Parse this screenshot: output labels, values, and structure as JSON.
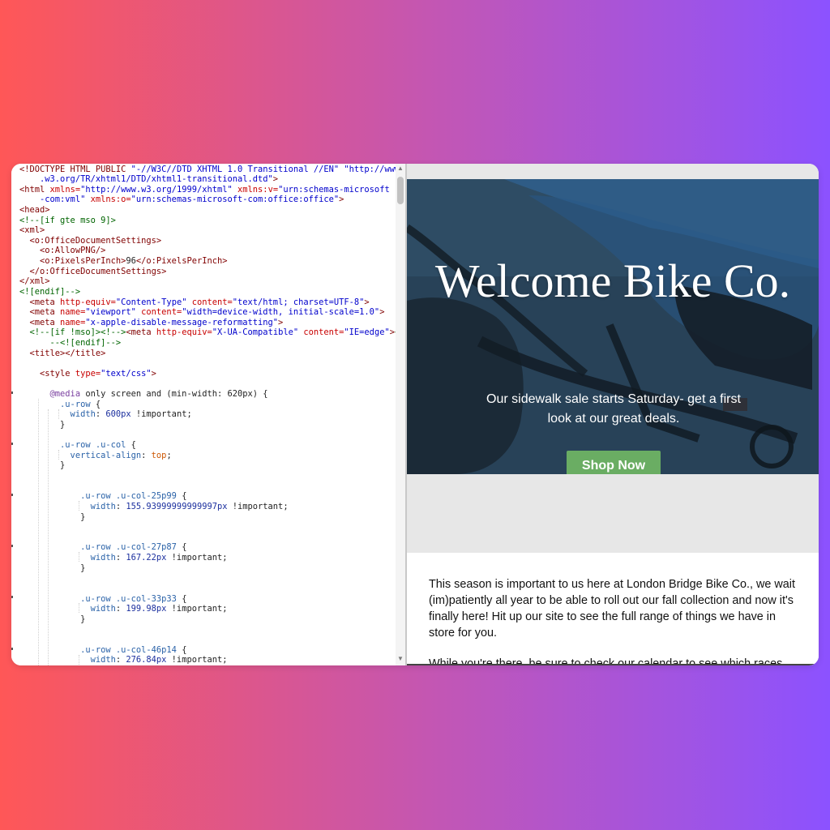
{
  "code_editor": {
    "lines": [
      [
        [
          "<!DOCTYPE HTML PUBLIC ",
          "c-tag"
        ],
        [
          "\"-//W3C//DTD XHTML 1.0 Transitional //EN\" \"http://www",
          "c-str"
        ]
      ],
      [
        [
          "    .w3.org/TR/xhtml1/DTD/xhtml1-transitional.dtd\"",
          "c-str"
        ],
        [
          ">",
          "c-tag"
        ]
      ],
      [
        [
          "<html ",
          "c-tag"
        ],
        [
          "xmlns=",
          "c-attr"
        ],
        [
          "\"http://www.w3.org/1999/xhtml\" ",
          "c-str"
        ],
        [
          "xmlns:v=",
          "c-attr"
        ],
        [
          "\"urn:schemas-microsoft",
          "c-str"
        ]
      ],
      [
        [
          "    -com:vml\" ",
          "c-str"
        ],
        [
          "xmlns:o=",
          "c-attr"
        ],
        [
          "\"urn:schemas-microsoft-com:office:office\"",
          "c-str"
        ],
        [
          ">",
          "c-tag"
        ]
      ],
      [
        [
          "<head>",
          "c-tag"
        ]
      ],
      [
        [
          "<!--[if gte mso 9]>",
          "c-cmt"
        ]
      ],
      [
        [
          "<xml>",
          "c-tag"
        ]
      ],
      [
        [
          "  <o:OfficeDocumentSettings>",
          "c-tag"
        ]
      ],
      [
        [
          "    <o:AllowPNG/>",
          "c-tag"
        ]
      ],
      [
        [
          "    <o:PixelsPerInch>",
          "c-tag"
        ],
        [
          "96",
          "c-punc"
        ],
        [
          "</o:PixelsPerInch>",
          "c-tag"
        ]
      ],
      [
        [
          "  </o:OfficeDocumentSettings>",
          "c-tag"
        ]
      ],
      [
        [
          "</xml>",
          "c-tag"
        ]
      ],
      [
        [
          "<![endif]-->",
          "c-cmt"
        ]
      ],
      [
        [
          "  <meta ",
          "c-tag"
        ],
        [
          "http-equiv=",
          "c-attr"
        ],
        [
          "\"Content-Type\" ",
          "c-str"
        ],
        [
          "content=",
          "c-attr"
        ],
        [
          "\"text/html; charset=UTF-8\"",
          "c-str"
        ],
        [
          ">",
          "c-tag"
        ]
      ],
      [
        [
          "  <meta ",
          "c-tag"
        ],
        [
          "name=",
          "c-attr"
        ],
        [
          "\"viewport\" ",
          "c-str"
        ],
        [
          "content=",
          "c-attr"
        ],
        [
          "\"width=device-width, initial-scale=1.0\"",
          "c-str"
        ],
        [
          ">",
          "c-tag"
        ]
      ],
      [
        [
          "  <meta ",
          "c-tag"
        ],
        [
          "name=",
          "c-attr"
        ],
        [
          "\"x-apple-disable-message-reformatting\"",
          "c-str"
        ],
        [
          ">",
          "c-tag"
        ]
      ],
      [
        [
          "  <!--[if !mso]><!-->",
          "c-cmt"
        ],
        [
          "<meta ",
          "c-tag"
        ],
        [
          "http-equiv=",
          "c-attr"
        ],
        [
          "\"X-UA-Compatible\" ",
          "c-str"
        ],
        [
          "content=",
          "c-attr"
        ],
        [
          "\"IE=edge\"",
          "c-str"
        ],
        [
          ">",
          "c-tag"
        ],
        [
          "<!",
          "c-cmt"
        ]
      ],
      [
        [
          "      --<![endif]-->",
          "c-cmt"
        ]
      ],
      [
        [
          "  <title></title>",
          "c-tag"
        ]
      ],
      [
        [
          "",
          "c-punc"
        ]
      ],
      [
        [
          "    <style ",
          "c-tag"
        ],
        [
          "type=",
          "c-attr"
        ],
        [
          "\"text/css\"",
          "c-str"
        ],
        [
          ">",
          "c-tag"
        ]
      ],
      [
        [
          "",
          "c-punc"
        ]
      ],
      [
        [
          "      @media ",
          "c-at"
        ],
        [
          "only screen and (min-width: 620px) {",
          "c-punc"
        ]
      ],
      [
        [
          "        .u-row ",
          "c-sel"
        ],
        [
          "{",
          "c-punc"
        ]
      ],
      [
        [
          "          width",
          "c-prop"
        ],
        [
          ": ",
          "c-punc"
        ],
        [
          "600px",
          "c-num"
        ],
        [
          " !important;",
          "c-punc"
        ]
      ],
      [
        [
          "        }",
          "c-punc"
        ]
      ],
      [
        [
          "",
          "c-punc"
        ]
      ],
      [
        [
          "        .u-row .u-col ",
          "c-sel"
        ],
        [
          "{",
          "c-punc"
        ]
      ],
      [
        [
          "          vertical-align",
          "c-prop"
        ],
        [
          ": ",
          "c-punc"
        ],
        [
          "top",
          "c-kw"
        ],
        [
          ";",
          "c-punc"
        ]
      ],
      [
        [
          "        }",
          "c-punc"
        ]
      ],
      [
        [
          "",
          "c-punc"
        ]
      ],
      [
        [
          "",
          "c-punc"
        ]
      ],
      [
        [
          "            .u-row .u-col-25p99 ",
          "c-sel"
        ],
        [
          "{",
          "c-punc"
        ]
      ],
      [
        [
          "              width",
          "c-prop"
        ],
        [
          ": ",
          "c-punc"
        ],
        [
          "155.93999999999997px",
          "c-num"
        ],
        [
          " !important;",
          "c-punc"
        ]
      ],
      [
        [
          "            }",
          "c-punc"
        ]
      ],
      [
        [
          "",
          "c-punc"
        ]
      ],
      [
        [
          "",
          "c-punc"
        ]
      ],
      [
        [
          "            .u-row .u-col-27p87 ",
          "c-sel"
        ],
        [
          "{",
          "c-punc"
        ]
      ],
      [
        [
          "              width",
          "c-prop"
        ],
        [
          ": ",
          "c-punc"
        ],
        [
          "167.22px",
          "c-num"
        ],
        [
          " !important;",
          "c-punc"
        ]
      ],
      [
        [
          "            }",
          "c-punc"
        ]
      ],
      [
        [
          "",
          "c-punc"
        ]
      ],
      [
        [
          "",
          "c-punc"
        ]
      ],
      [
        [
          "            .u-row .u-col-33p33 ",
          "c-sel"
        ],
        [
          "{",
          "c-punc"
        ]
      ],
      [
        [
          "              width",
          "c-prop"
        ],
        [
          ": ",
          "c-punc"
        ],
        [
          "199.98px",
          "c-num"
        ],
        [
          " !important;",
          "c-punc"
        ]
      ],
      [
        [
          "            }",
          "c-punc"
        ]
      ],
      [
        [
          "",
          "c-punc"
        ]
      ],
      [
        [
          "",
          "c-punc"
        ]
      ],
      [
        [
          "            .u-row .u-col-46p14 ",
          "c-sel"
        ],
        [
          "{",
          "c-punc"
        ]
      ],
      [
        [
          "              width",
          "c-prop"
        ],
        [
          ": ",
          "c-punc"
        ],
        [
          "276.84px",
          "c-num"
        ],
        [
          " !important;",
          "c-punc"
        ]
      ]
    ]
  },
  "scrollbar": {
    "up_arrow": "▲",
    "down_arrow": "▼"
  },
  "preview": {
    "hero_title": "Welcome Bike Co.",
    "hero_subtitle": "Our sidewalk sale starts Saturday- get a first look at our great deals.",
    "cta_label": "Shop Now",
    "cta_color": "#6aad63",
    "body_paragraphs": [
      "This season is important to us here at London Bridge Bike Co., we wait (im)patiently all year to be able to roll out our fall collection and now it's finally here! Hit up our site to see the full range of things we have in store for you.",
      "While you're there, be sure to check our calendar to see which races"
    ]
  },
  "colors": {
    "bg_left": "#ff5757",
    "bg_right": "#8c52ff",
    "preview_gray": "#e7e7e7"
  }
}
